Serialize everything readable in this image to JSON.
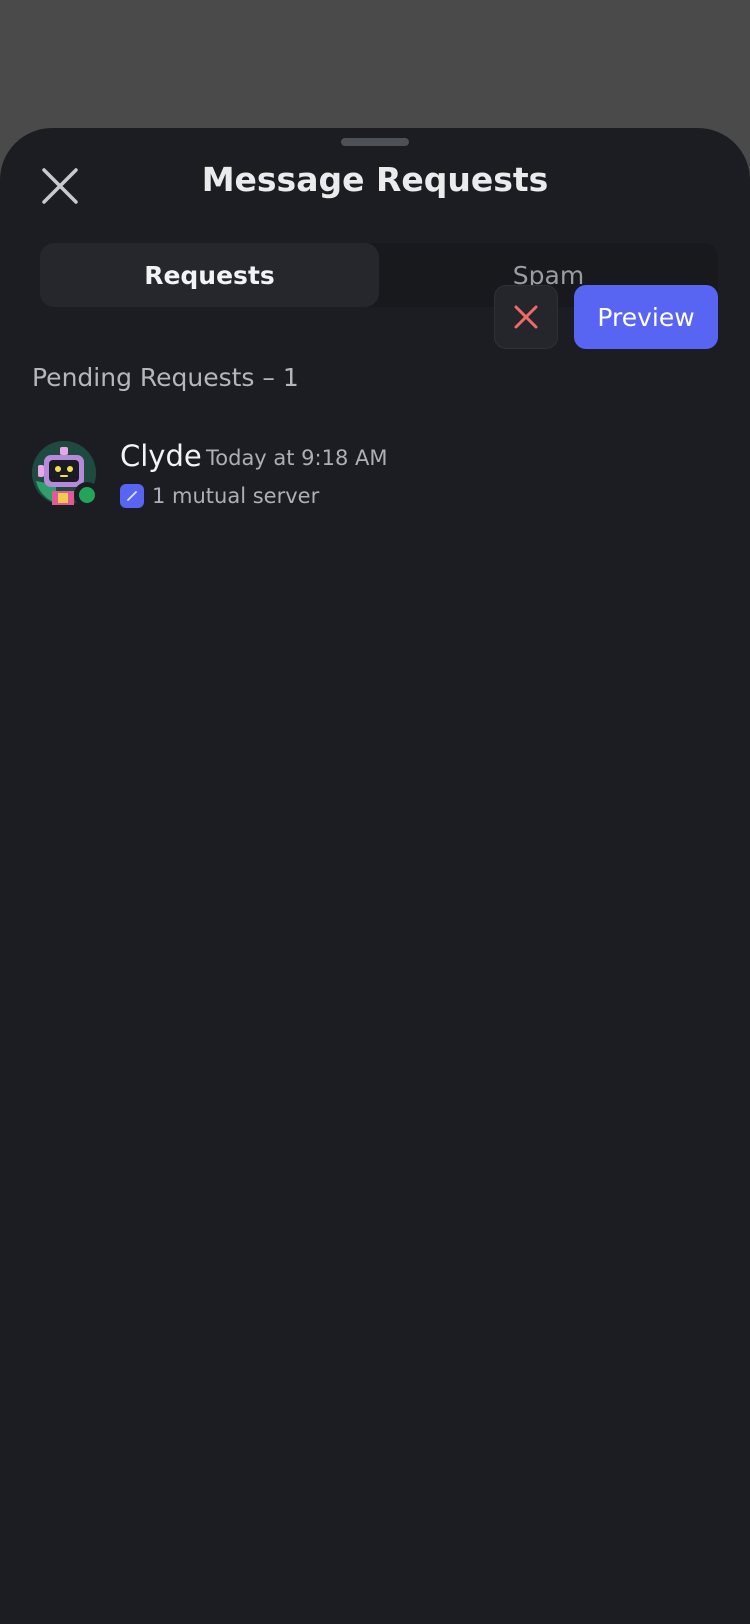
{
  "header": {
    "title": "Message Requests"
  },
  "tabs": [
    {
      "label": "Requests",
      "active": true
    },
    {
      "label": "Spam",
      "active": false
    }
  ],
  "section": {
    "heading": "Pending Requests – 1"
  },
  "requests": [
    {
      "name": "Clyde",
      "timestamp": "Today at 9:18 AM",
      "mutual": "1 mutual server",
      "status": "online",
      "preview_label": "Preview"
    }
  ],
  "colors": {
    "accent": "#5865f2",
    "online": "#23a559",
    "decline": "#f06a6a",
    "background": "#1c1d22"
  },
  "icons": {
    "close": "close-icon",
    "decline": "x-icon",
    "server": "server-icon"
  }
}
